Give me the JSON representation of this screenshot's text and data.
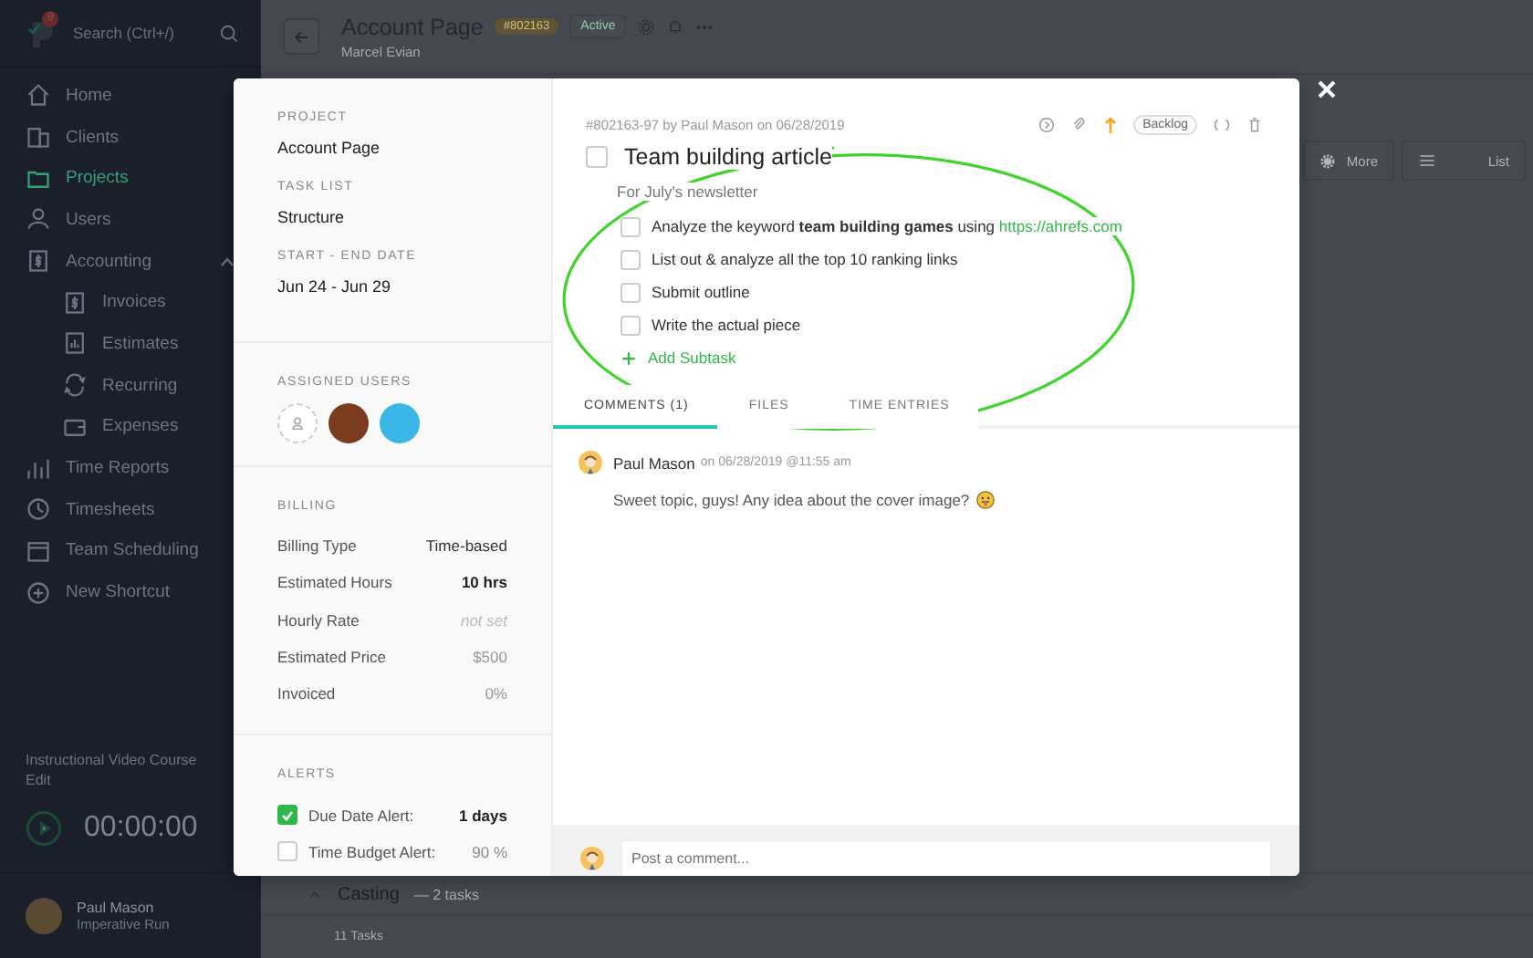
{
  "sidebar": {
    "notification_count": "9",
    "search": {
      "placeholder": "Search (Ctrl+/)"
    },
    "items": [
      {
        "label": "Home",
        "selected": false
      },
      {
        "label": "Clients",
        "selected": false
      },
      {
        "label": "Projects",
        "selected": true
      },
      {
        "label": "Users",
        "selected": false
      },
      {
        "label": "Accounting",
        "selected": false,
        "expanded": true,
        "children": [
          {
            "label": "Invoices",
            "selected": false
          },
          {
            "label": "Estimates",
            "selected": false
          },
          {
            "label": "Recurring",
            "selected": false
          },
          {
            "label": "Expenses",
            "selected": false
          }
        ]
      },
      {
        "label": "Time Reports",
        "selected": false
      },
      {
        "label": "Timesheets",
        "selected": false
      },
      {
        "label": "Team Scheduling",
        "selected": false
      },
      {
        "label": "New Shortcut",
        "selected": false
      }
    ],
    "video_course": {
      "title": "Instructional Video Course",
      "action": "Edit"
    },
    "timer": "00:00:00",
    "user": {
      "name": "Paul Mason",
      "subtitle": "Imperative Run"
    }
  },
  "page_header": {
    "title": "Account Page",
    "badge": "#802163",
    "status": "Active",
    "subtitle": "Marcel Evian"
  },
  "toolbar": {
    "more": "More",
    "view": "List"
  },
  "task_group": {
    "title": "Casting",
    "count": "— 2 tasks",
    "footer": "11 Tasks"
  },
  "modal": {
    "details": [
      {
        "label": "PROJECT",
        "value": "Account Page"
      },
      {
        "label": "TASK LIST",
        "value": "Structure"
      },
      {
        "label": "START - END DATE",
        "value": "Jun 24 - Jun 29"
      }
    ],
    "assigned_users": {
      "label": "ASSIGNED USERS",
      "users": [
        {
          "color": "#7a3b1f"
        },
        {
          "color": "#3bb6e6"
        }
      ]
    },
    "billing": {
      "label": "BILLING",
      "rows": [
        {
          "label": "Billing Type",
          "value": "Time-based",
          "kind": "normal"
        },
        {
          "label": "Estimated Hours",
          "value": "10 hrs",
          "kind": "strong"
        },
        {
          "label": "Hourly Rate",
          "value": "not set",
          "kind": "unset"
        },
        {
          "label": "Estimated Price",
          "value": "$500",
          "kind": "muted"
        },
        {
          "label": "Invoiced",
          "value": "0%",
          "kind": "muted"
        }
      ]
    },
    "alerts": {
      "label": "ALERTS",
      "items": [
        {
          "label": "Due Date Alert:",
          "value": "1 days",
          "checked": true
        },
        {
          "label": "Time Budget Alert:",
          "value": "90 %",
          "checked": false
        }
      ]
    },
    "meta": "#802163-97 by Paul Mason on 06/28/2019",
    "status_tag": "Backlog",
    "task": {
      "title": "Team building article",
      "completed": false,
      "description": "For July's newsletter"
    },
    "subtasks": [
      {
        "text": "Analyze the keyword **team building games** using",
        "link": "https://ahrefs.com",
        "checked": false
      },
      {
        "text": "List out & analyze all the top 10 ranking links",
        "checked": false
      },
      {
        "text": "Submit outline",
        "checked": false
      },
      {
        "text": "Write the actual piece",
        "checked": false
      }
    ],
    "add_subtask": "Add Subtask",
    "tabs": [
      {
        "label": "COMMENTS (1)",
        "selected": true
      },
      {
        "label": "FILES",
        "selected": false
      },
      {
        "label": "TIME ENTRIES",
        "selected": false
      }
    ],
    "comments": [
      {
        "author": "Paul Mason",
        "time": "on 06/28/2019 @11:55 am",
        "text": "Sweet topic, guys! Any idea about the cover image?"
      }
    ],
    "comment_box": {
      "placeholder": "Post a comment..."
    }
  }
}
